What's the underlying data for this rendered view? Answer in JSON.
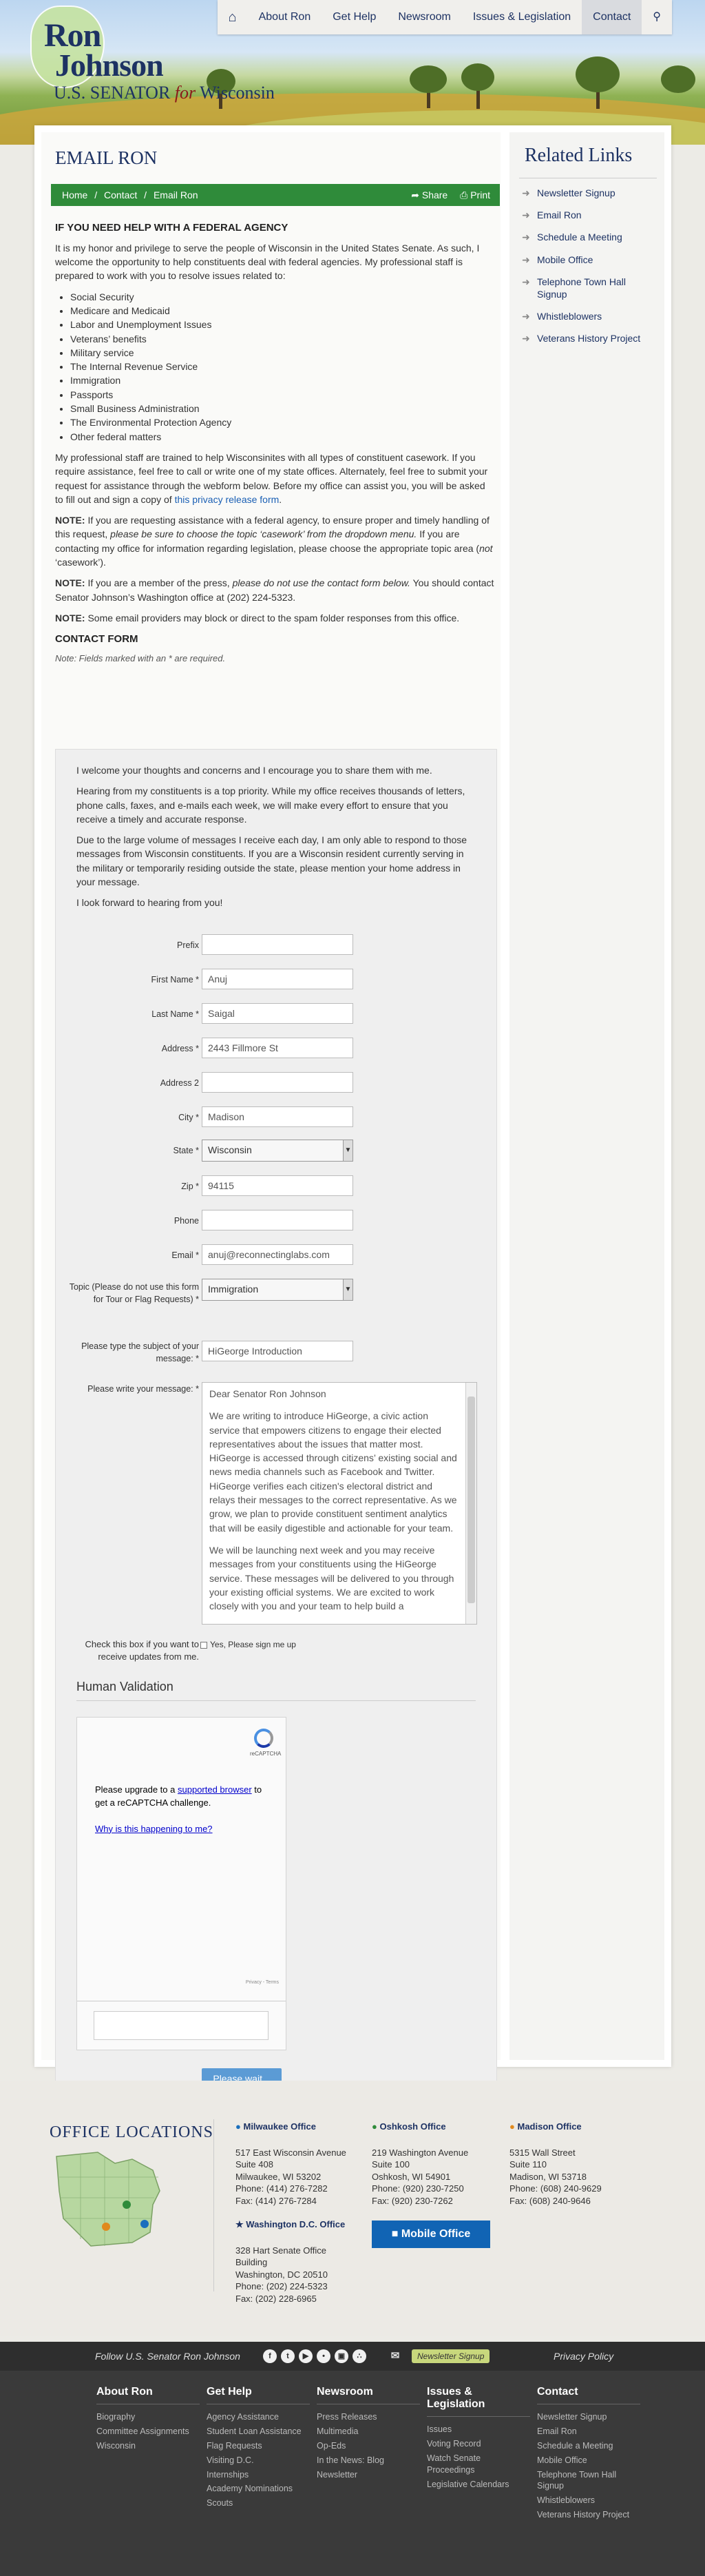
{
  "nav": {
    "home_icon": "home-icon",
    "items": [
      "About Ron",
      "Get Help",
      "Newsroom",
      "Issues & Legislation",
      "Contact"
    ],
    "search_icon": "search-icon"
  },
  "logo": {
    "line1": "Ron",
    "line2": "Johnson",
    "line3a": "U.S. SENATOR",
    "line3b": "for",
    "line3c": "Wisconsin"
  },
  "page": {
    "title": "EMAIL RON"
  },
  "breadcrumb": {
    "home": "Home",
    "sep": "/",
    "contact": "Contact",
    "current": "Email Ron",
    "share": "Share",
    "print": "Print"
  },
  "content": {
    "heading": "IF YOU NEED HELP WITH A FEDERAL AGENCY",
    "p1": "It is my honor and privilege to serve the people of Wisconsin in the United States Senate. As such, I welcome the opportunity to help constituents deal with federal agencies. My professional staff is prepared to work with you to resolve issues related to:",
    "list": [
      "Social Security",
      "Medicare and Medicaid",
      "Labor and Unemployment Issues",
      "Veterans’ benefits",
      "Military service",
      "The Internal Revenue Service",
      "Immigration",
      "Passports",
      "Small Business Administration",
      "The Environmental Protection Agency",
      "Other federal matters"
    ],
    "p2": "My professional staff are trained to help Wisconsinites with all types of constituent casework. If you require assistance, feel free to call or write one of my state offices. Alternately, feel free to submit your request for assistance through the webform below. Before my office can assist you, you will be asked to fill out and sign a copy of",
    "p2_link": "this privacy release form",
    "p2_end": ".",
    "note1_label": "NOTE:",
    "note1_a": "If you are requesting assistance with a federal agency, to ensure proper and timely handling of this request,",
    "note1_b": "please be sure to choose the topic ‘casework’ from the dropdown menu.",
    "note1_c": "If you are contacting my office for information regarding legislation, please choose the appropriate topic area (",
    "note1_d": "not",
    "note1_e": "‘casework’).",
    "note2_label": "NOTE:",
    "note2_a": "If you are a member of the press,",
    "note2_b": "please do not use the contact form below.",
    "note2_c": "You should contact Senator Johnson’s Washington office at (202) 224-5323.",
    "note3_label": "NOTE:",
    "note3_a": "Some email providers may block or direct to the spam folder responses from this office.",
    "contact_heading": "CONTACT FORM",
    "required_note": "Note: Fields marked with an * are required."
  },
  "form": {
    "intro1": "I welcome your thoughts and concerns and I encourage you to share them with me.",
    "intro2": "Hearing from my constituents is a top priority. While my office receives thousands of letters, phone calls, faxes, and e-mails each week, we will make every effort to ensure that you receive a timely and accurate response.",
    "intro3": "Due to the large volume of messages I receive each day, I am only able to respond to those messages from Wisconsin constituents. If you are a Wisconsin resident currently serving in the military or temporarily residing outside the state, please mention your home address in your message.",
    "intro4": "I look forward to hearing from you!",
    "prefix_label": "Prefix",
    "prefix_value": "",
    "first_label": "First Name *",
    "first_value": "Anuj",
    "last_label": "Last Name *",
    "last_value": "Saigal",
    "address_label": "Address *",
    "address_value": "2443 Fillmore St",
    "address2_label": "Address 2",
    "address2_value": "",
    "city_label": "City *",
    "city_value": "Madison",
    "state_label": "State *",
    "state_value": "Wisconsin",
    "zip_label": "Zip *",
    "zip_value": "94115",
    "phone_label": "Phone",
    "phone_value": "",
    "email_label": "Email *",
    "email_value": "anuj@reconnectinglabs.com",
    "topic_label": "Topic (Please do not use this form for Tour or Flag Requests) *",
    "topic_value": "Immigration",
    "subject_label": "Please type the subject of your message: *",
    "subject_value": "HiGeorge Introduction",
    "message_label": "Please write your message: *",
    "message_p1": "Dear Senator Ron Johnson",
    "message_p2": "We are writing to introduce HiGeorge, a civic action service that empowers citizens to engage their elected representatives about the issues that matter most. HiGeorge is accessed through citizens’ existing social and news media channels such as Facebook and Twitter.  HiGeorge verifies each citizen's electoral district and relays their messages to the correct representative.  As we grow, we plan to provide constituent sentiment analytics that will be easily digestible and actionable for your team.",
    "message_p3": "We will be launching next week and you may receive messages from your constituents using the HiGeorge service. These messages will be delivered to you through your existing official systems. We are excited to work closely with you and your team to help build a",
    "updates_label": "Check this box if you want to receive updates from me.",
    "updates_option": "Yes, Please sign me up",
    "hv_title": "Human Validation",
    "captcha_brand": "reCAPTCHA",
    "captcha_msg": "Please upgrade to a",
    "captcha_link": "supported browser",
    "captcha_msg2": "to get a reCAPTCHA challenge.",
    "captcha_why": "Why is this happening to me?",
    "captcha_terms": "Privacy - Terms",
    "submit": "Please wait..."
  },
  "sidebar": {
    "title": "Related Links",
    "items": [
      "Newsletter Signup",
      "Email Ron",
      "Schedule a Meeting",
      "Mobile Office",
      "Telephone Town Hall Signup",
      "Whistleblowers",
      "Veterans History Project"
    ]
  },
  "offices": {
    "title": "OFFICE LOCATIONS",
    "milwaukee": {
      "name": "Milwaukee Office",
      "lines": [
        "517 East Wisconsin Avenue",
        "Suite 408",
        "Milwaukee, WI 53202",
        "Phone: (414) 276-7282",
        "Fax: (414) 276-7284"
      ]
    },
    "oshkosh": {
      "name": "Oshkosh Office",
      "lines": [
        "219 Washington Avenue",
        "Suite 100",
        "Oshkosh, WI 54901",
        "Phone: (920) 230-7250",
        "Fax: (920) 230-7262"
      ]
    },
    "madison": {
      "name": "Madison Office",
      "lines": [
        "5315 Wall Street",
        "Suite 110",
        "Madison, WI 53718",
        "Phone: (608) 240-9629",
        "Fax: (608) 240-9646"
      ]
    },
    "dc": {
      "name": "Washington D.C. Office",
      "lines": [
        "328 Hart Senate Office",
        "Building",
        "Washington, DC 20510",
        "Phone: (202) 224-5323",
        "Fax: (202) 228-6965"
      ]
    },
    "mobile": "Mobile Office",
    "pin_colors": {
      "milwaukee": "#1a6fbd",
      "oshkosh": "#2f8b3a",
      "madison": "#e08a1e"
    }
  },
  "follow": {
    "text": "Follow U.S. Senator Ron Johnson",
    "newsletter": "Newsletter Signup",
    "privacy": "Privacy Policy"
  },
  "footer": {
    "col1": {
      "title": "About Ron",
      "items": [
        "Biography",
        "Committee Assignments",
        "Wisconsin"
      ]
    },
    "col2": {
      "title": "Get Help",
      "items": [
        "Agency Assistance",
        "Student Loan Assistance",
        "Flag Requests",
        "Visiting D.C.",
        "Internships",
        "Academy Nominations",
        "Scouts"
      ]
    },
    "col3": {
      "title": "Newsroom",
      "items": [
        "Press Releases",
        "Multimedia",
        "Op-Eds",
        "In the News: Blog",
        "Newsletter"
      ]
    },
    "col4": {
      "title": "Issues & Legislation",
      "items": [
        "Issues",
        "Voting Record",
        "Watch Senate Proceedings",
        "Legislative Calendars"
      ]
    },
    "col5": {
      "title": "Contact",
      "items": [
        "Newsletter Signup",
        "Email Ron",
        "Schedule a Meeting",
        "Mobile Office",
        "Telephone Town Hall Signup",
        "Whistleblowers",
        "Veterans History Project"
      ]
    }
  }
}
